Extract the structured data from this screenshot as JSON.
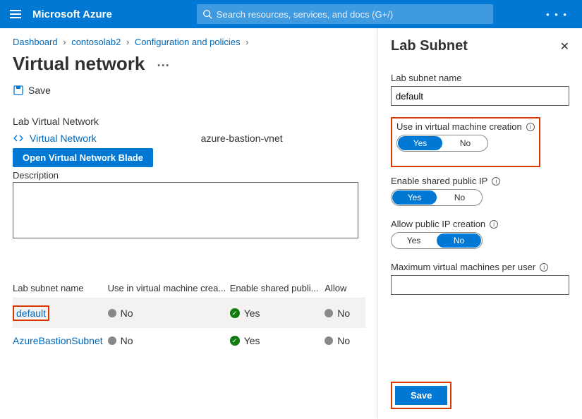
{
  "topbar": {
    "brand": "Microsoft Azure",
    "search_placeholder": "Search resources, services, and docs (G+/)"
  },
  "breadcrumbs": {
    "b1": "Dashboard",
    "b2": "contosolab2",
    "b3": "Configuration and policies"
  },
  "page": {
    "title": "Virtual network",
    "save_label": "Save",
    "section_label": "Lab Virtual Network",
    "vnet_link_label": "Virtual Network",
    "vnet_name": "azure-bastion-vnet",
    "open_blade_btn": "Open Virtual Network Blade",
    "desc_label": "Description",
    "desc_value": ""
  },
  "table": {
    "headers": {
      "c1": "Lab subnet name",
      "c2": "Use in virtual machine crea...",
      "c3": "Enable shared publi...",
      "c4": "Allow"
    },
    "rows": [
      {
        "name": "default",
        "use": "No",
        "shared": "Yes",
        "allow": "No",
        "selected": true,
        "highlight": true
      },
      {
        "name": "AzureBastionSubnet",
        "use": "No",
        "shared": "Yes",
        "allow": "No",
        "selected": false,
        "highlight": false
      }
    ]
  },
  "panel": {
    "title": "Lab Subnet",
    "labels": {
      "name": "Lab subnet name",
      "use": "Use in virtual machine creation",
      "shared": "Enable shared public IP",
      "allow": "Allow public IP creation",
      "max": "Maximum virtual machines per user"
    },
    "fields": {
      "name_value": "default",
      "use_yes": "Yes",
      "use_no": "No",
      "use_value": "Yes",
      "shared_yes": "Yes",
      "shared_no": "No",
      "shared_value": "Yes",
      "allow_yes": "Yes",
      "allow_no": "No",
      "allow_value": "No",
      "max_value": ""
    },
    "save_label": "Save"
  }
}
